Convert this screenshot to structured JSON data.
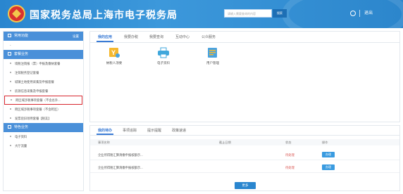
{
  "header": {
    "title": "国家税务总局上海市电子税务局",
    "search_placeholder": "请输入需要查询的内容",
    "search_button": "搜索",
    "logout": "退出"
  },
  "sidebar": {
    "common_label": "常用功能",
    "common_extra": "设置",
    "common_items": [
      "-"
    ],
    "apply_label": "套餐业务",
    "apply_items": [
      "境税注销报（票）申报及缴纳套餐",
      "注销税务登记套餐",
      "城镇土地使用采集及申报套餐",
      "房源信息采集及申报套餐",
      "跨区域涉税事项套餐（不含总外...",
      "跨区域涉税事项套餐（不含跨区）",
      "发票验旧领用套餐【税友】"
    ],
    "special_label": "特色业务",
    "special_items": [
      "电子资料",
      "大厅流量"
    ]
  },
  "main": {
    "tabs": [
      "我的应用",
      "我要办税",
      "我要查询",
      "互动中心",
      "公众服务"
    ],
    "apps": [
      {
        "label": "纳税人须要",
        "icon": "taxpayer-icon"
      },
      {
        "label": "电子资料",
        "icon": "printer-icon"
      },
      {
        "label": "用户管理",
        "icon": "user-manage-icon"
      }
    ]
  },
  "todo": {
    "tabs": [
      "我的待办",
      "事项追踪",
      "提示提醒",
      "政策速递"
    ],
    "columns": [
      "事项名称",
      "截止日期",
      "状态",
      "操作"
    ],
    "rows": [
      {
        "name": "企业所得税汇算清缴申报核额示...",
        "deadline": "",
        "status": "待处理",
        "action": "办理"
      },
      {
        "name": "企业所得税汇算清缴申报核额示...",
        "deadline": "",
        "status": "待处理",
        "action": "办理"
      }
    ],
    "more": "更多"
  },
  "colors": {
    "brand": "#2a86cf",
    "accent": "#3a7bd5",
    "status": "#d9534f",
    "highlight_box": "#d7262e"
  }
}
